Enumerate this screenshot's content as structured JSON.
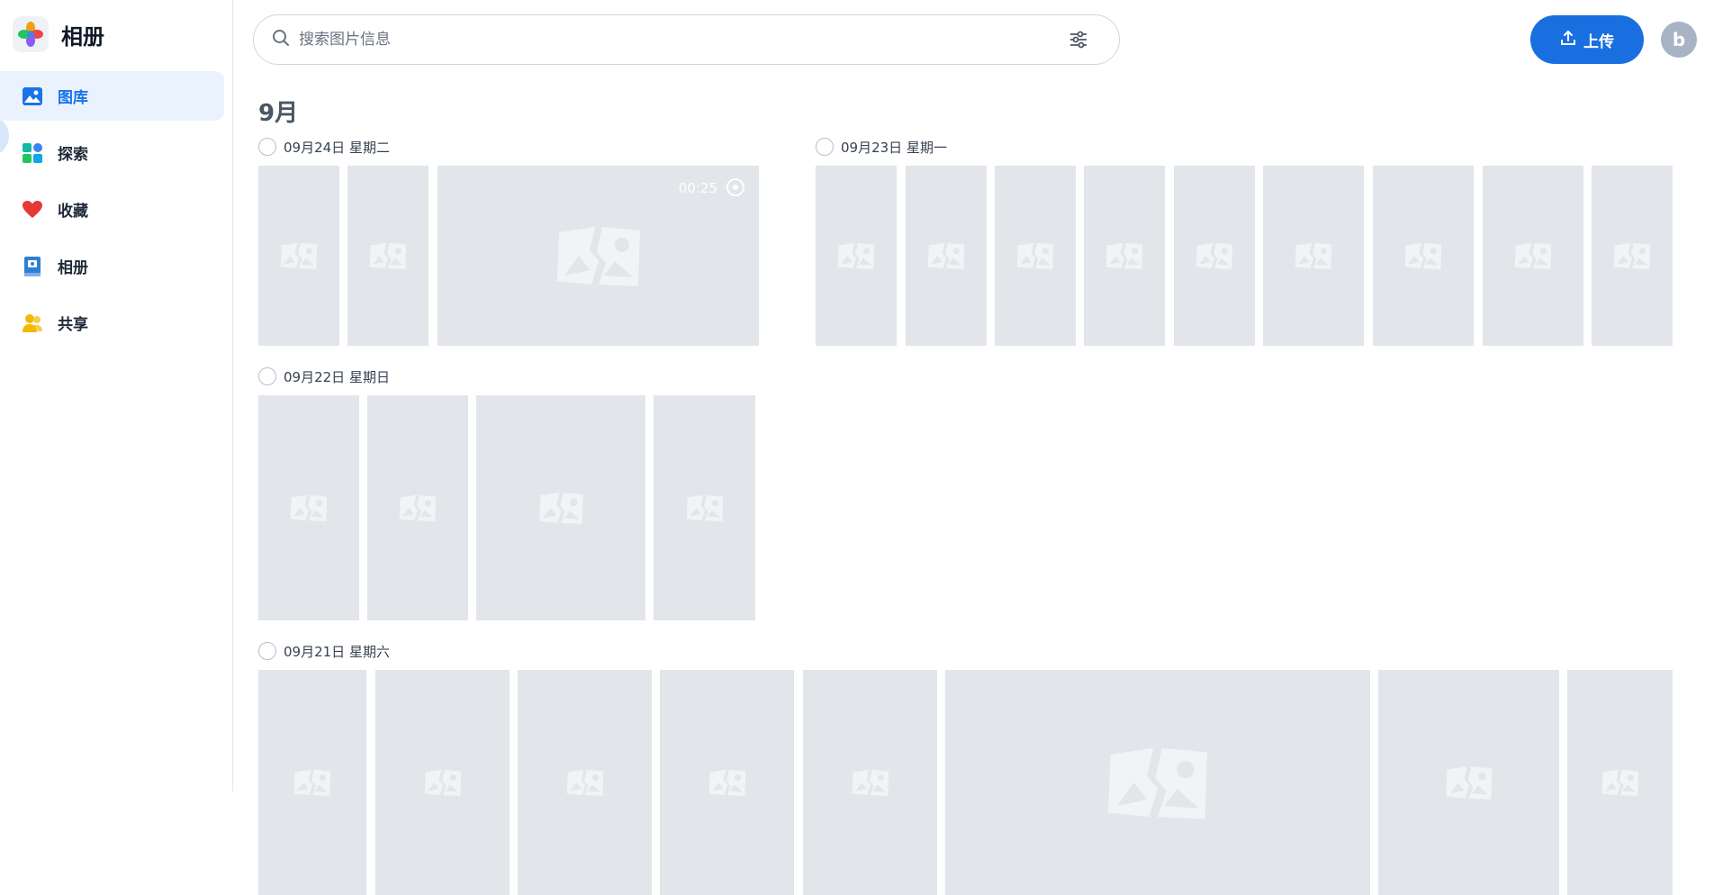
{
  "app": {
    "title": "相册"
  },
  "sidebar": {
    "items": [
      {
        "label": "图库",
        "icon": "gallery-icon",
        "active": true
      },
      {
        "label": "探索",
        "icon": "explore-icon",
        "active": false
      },
      {
        "label": "收藏",
        "icon": "heart-icon",
        "active": false
      },
      {
        "label": "相册",
        "icon": "album-icon",
        "active": false
      },
      {
        "label": "共享",
        "icon": "share-icon",
        "active": false
      }
    ]
  },
  "search": {
    "placeholder": "搜索图片信息",
    "value": ""
  },
  "toolbar": {
    "upload_label": "上传",
    "avatar_letter": "b"
  },
  "colors": {
    "accent": "#1a6fe0",
    "active_bg": "#eaf3fd",
    "thumb_bg": "#e2e5e9"
  },
  "gallery": {
    "month": "9月",
    "days": [
      {
        "date": "09月24日 星期二",
        "video_duration": "00:25"
      },
      {
        "date": "09月23日 星期一"
      },
      {
        "date": "09月22日 星期日"
      },
      {
        "date": "09月21日 星期六"
      }
    ]
  }
}
